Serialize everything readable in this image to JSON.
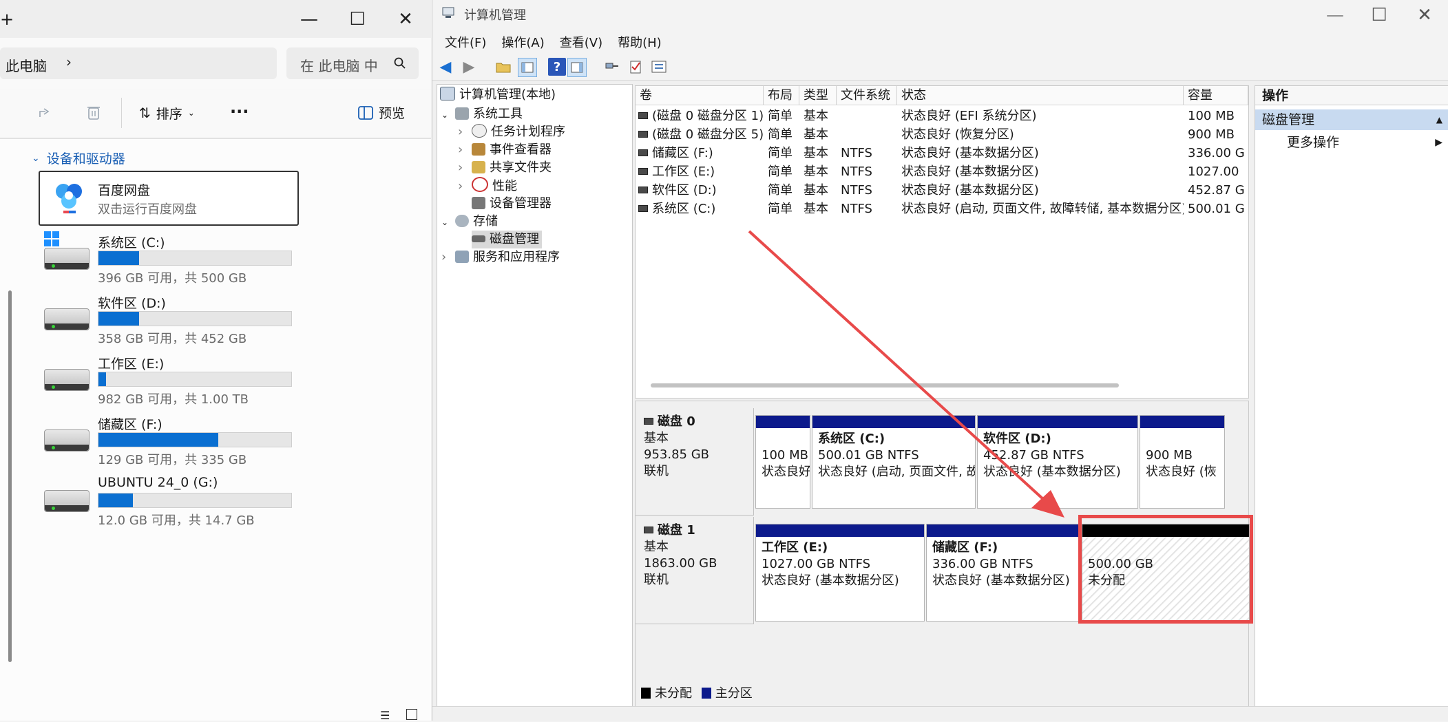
{
  "explorer": {
    "window_controls": {
      "minimize": "—",
      "maximize": "☐",
      "close": "✕"
    },
    "breadcrumb": "此电脑",
    "search_placeholder": "在 此电脑 中",
    "toolbar": {
      "sort_label": "排序",
      "more_label": "···",
      "preview_label": "预览"
    },
    "section_title": "设备和驱动器",
    "baidu": {
      "name": "百度网盘",
      "desc": "双击运行百度网盘"
    },
    "drives": [
      {
        "name": "系统区 (C:)",
        "sub": "396 GB 可用，共 500 GB",
        "used_pct": 21,
        "windows_logo": true
      },
      {
        "name": "软件区 (D:)",
        "sub": "358 GB 可用，共 452 GB",
        "used_pct": 21
      },
      {
        "name": "工作区 (E:)",
        "sub": "982 GB 可用，共 1.00 TB",
        "used_pct": 4
      },
      {
        "name": "储藏区 (F:)",
        "sub": "129 GB 可用，共 335 GB",
        "used_pct": 62
      },
      {
        "name": "UBUNTU 24_0 (G:)",
        "sub": "12.0 GB 可用，共 14.7 GB",
        "used_pct": 18
      }
    ]
  },
  "mmc": {
    "title": "计算机管理",
    "menu": [
      "文件(F)",
      "操作(A)",
      "查看(V)",
      "帮助(H)"
    ],
    "tree": {
      "root": "计算机管理(本地)",
      "system_tools": "系统工具",
      "task_scheduler": "任务计划程序",
      "event_viewer": "事件查看器",
      "shared_folders": "共享文件夹",
      "performance": "性能",
      "device_manager": "设备管理器",
      "storage": "存储",
      "disk_management": "磁盘管理",
      "services_apps": "服务和应用程序"
    },
    "volumes": {
      "headers": [
        "卷",
        "布局",
        "类型",
        "文件系统",
        "状态",
        "容量"
      ],
      "rows": [
        [
          "(磁盘 0 磁盘分区 1)",
          "简单",
          "基本",
          "",
          "状态良好 (EFI 系统分区)",
          "100 MB"
        ],
        [
          "(磁盘 0 磁盘分区 5)",
          "简单",
          "基本",
          "",
          "状态良好 (恢复分区)",
          "900 MB"
        ],
        [
          "储藏区 (F:)",
          "简单",
          "基本",
          "NTFS",
          "状态良好 (基本数据分区)",
          "336.00 G"
        ],
        [
          "工作区 (E:)",
          "简单",
          "基本",
          "NTFS",
          "状态良好 (基本数据分区)",
          "1027.00"
        ],
        [
          "软件区 (D:)",
          "简单",
          "基本",
          "NTFS",
          "状态良好 (基本数据分区)",
          "452.87 G"
        ],
        [
          "系统区 (C:)",
          "简单",
          "基本",
          "NTFS",
          "状态良好 (启动, 页面文件, 故障转储, 基本数据分区)",
          "500.01 G"
        ]
      ]
    },
    "disk0": {
      "name": "磁盘 0",
      "type": "基本",
      "size": "953.85 GB",
      "status": "联机",
      "parts": [
        {
          "line1": "",
          "line2": "100 MB",
          "line3": "状态良好"
        },
        {
          "line1": "系统区  (C:)",
          "line2": "500.01 GB NTFS",
          "line3": "状态良好 (启动, 页面文件, 故"
        },
        {
          "line1": "软件区  (D:)",
          "line2": "452.87 GB NTFS",
          "line3": "状态良好 (基本数据分区)"
        },
        {
          "line1": "",
          "line2": "900 MB",
          "line3": "状态良好 (恢"
        }
      ]
    },
    "disk1": {
      "name": "磁盘 1",
      "type": "基本",
      "size": "1863.00 GB",
      "status": "联机",
      "parts": [
        {
          "line1": "工作区  (E:)",
          "line2": "1027.00 GB NTFS",
          "line3": "状态良好 (基本数据分区)"
        },
        {
          "line1": "储藏区  (F:)",
          "line2": "336.00 GB NTFS",
          "line3": "状态良好 (基本数据分区)"
        },
        {
          "line1": "",
          "line2": "500.00 GB",
          "line3": "未分配"
        }
      ]
    },
    "legend": {
      "unallocated": "未分配",
      "primary": "主分区"
    },
    "actions": {
      "header": "操作",
      "section": "磁盘管理",
      "more": "更多操作"
    },
    "colors": {
      "primary_partition": "#0c1a8c",
      "unallocated": "#000000",
      "annotation": "#e84a4a",
      "selection": "#cfe3f7"
    }
  }
}
